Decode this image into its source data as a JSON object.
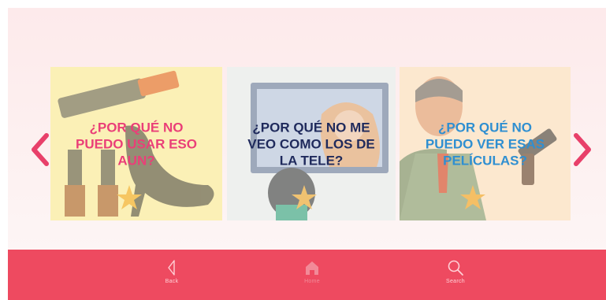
{
  "colors": {
    "accent": "#ee4a60",
    "arrow": "#e8406a",
    "card_title_pink": "#ea3f78",
    "card_title_navy": "#1f2a5c",
    "card_title_blue": "#2f8fd1"
  },
  "carousel": {
    "cards": [
      {
        "title": "¿POR QUÉ NO\nPUEDO USAR ESO\nAUN?"
      },
      {
        "title": "¿POR QUÉ NO ME\nVEO COMO LOS DE\nLA TELE?"
      },
      {
        "title": "¿POR QUÉ NO\nPUEDO VER ESAS\nPELÍCULAS?"
      }
    ],
    "prev_icon": "chevron-left-icon",
    "next_icon": "chevron-right-icon"
  },
  "bottom_nav": {
    "back": {
      "label": "Back",
      "icon": "back-arrow-icon"
    },
    "home": {
      "label": "Home",
      "icon": "home-icon"
    },
    "search": {
      "label": "Search",
      "icon": "search-icon"
    }
  }
}
